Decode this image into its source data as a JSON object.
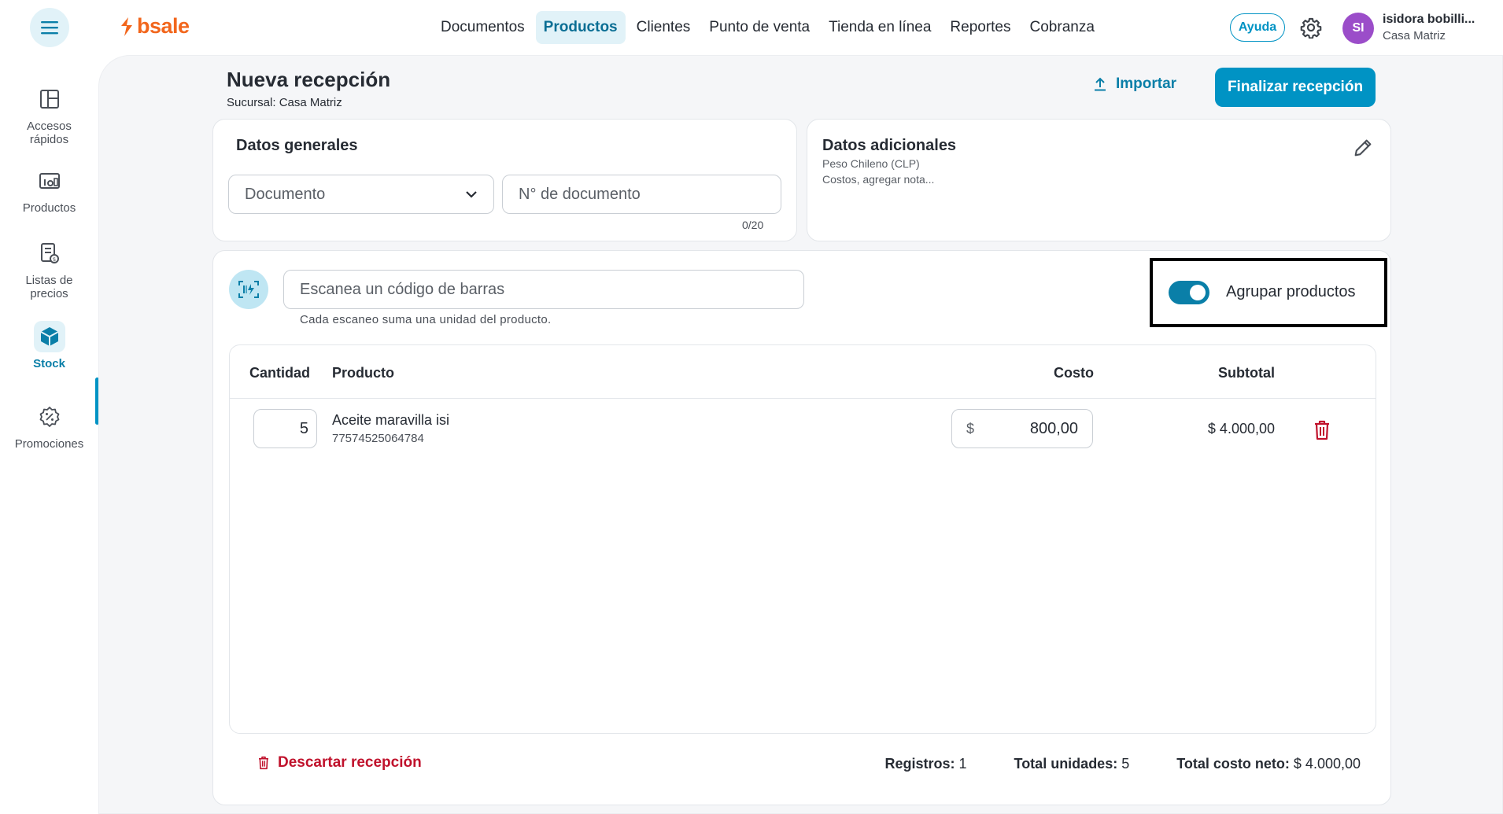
{
  "brand": {
    "name": "bsale",
    "color": "#f2661c"
  },
  "topnav": {
    "items": [
      "Documentos",
      "Productos",
      "Clientes",
      "Punto de venta",
      "Tienda en línea",
      "Reportes",
      "Cobranza"
    ],
    "active": "Productos",
    "help_label": "Ayuda",
    "settings_icon": "gear-icon"
  },
  "user": {
    "initials": "SI",
    "name": "isidora bobilli...",
    "branch": "Casa Matriz",
    "avatar_color": "#9b4dc9"
  },
  "sidebar": {
    "items": [
      {
        "label": "Accesos rápidos",
        "icon": "layout-grid-icon"
      },
      {
        "label": "Productos",
        "icon": "products-icon"
      },
      {
        "label": "Listas de precios",
        "icon": "price-list-icon"
      },
      {
        "label": "Stock",
        "icon": "box-icon",
        "active": true
      },
      {
        "label": "Promociones",
        "icon": "promotion-badge-icon"
      }
    ]
  },
  "page": {
    "title": "Nueva recepción",
    "subtitle": "Sucursal: Casa Matriz",
    "import_label": "Importar",
    "finish_label": "Finalizar recepción"
  },
  "general": {
    "title": "Datos generales",
    "document_select": "Documento",
    "document_number_placeholder": "N° de documento",
    "counter": "0/20"
  },
  "additional": {
    "title": "Datos adicionales",
    "currency": "Peso Chileno (CLP)",
    "hint": "Costos, agregar nota..."
  },
  "scanner": {
    "placeholder": "Escanea un código de barras",
    "hint": "Cada escaneo suma una unidad del producto.",
    "group_label": "Agrupar productos",
    "group_enabled": true
  },
  "table": {
    "headers": {
      "quantity": "Cantidad",
      "product": "Producto",
      "cost": "Costo",
      "subtotal": "Subtotal"
    },
    "rows": [
      {
        "quantity": "5",
        "name": "Aceite maravilla isi",
        "code": "77574525064784",
        "currency": "$",
        "cost": "800,00",
        "subtotal": "$ 4.000,00"
      }
    ]
  },
  "footer": {
    "discard_label": "Descartar recepción",
    "records_label": "Registros:",
    "records_value": "1",
    "units_label": "Total unidades:",
    "units_value": "5",
    "net_label": "Total costo neto:",
    "net_value": "$ 4.000,00"
  },
  "colors": {
    "accent": "#0093c4",
    "danger": "#c0122c"
  }
}
